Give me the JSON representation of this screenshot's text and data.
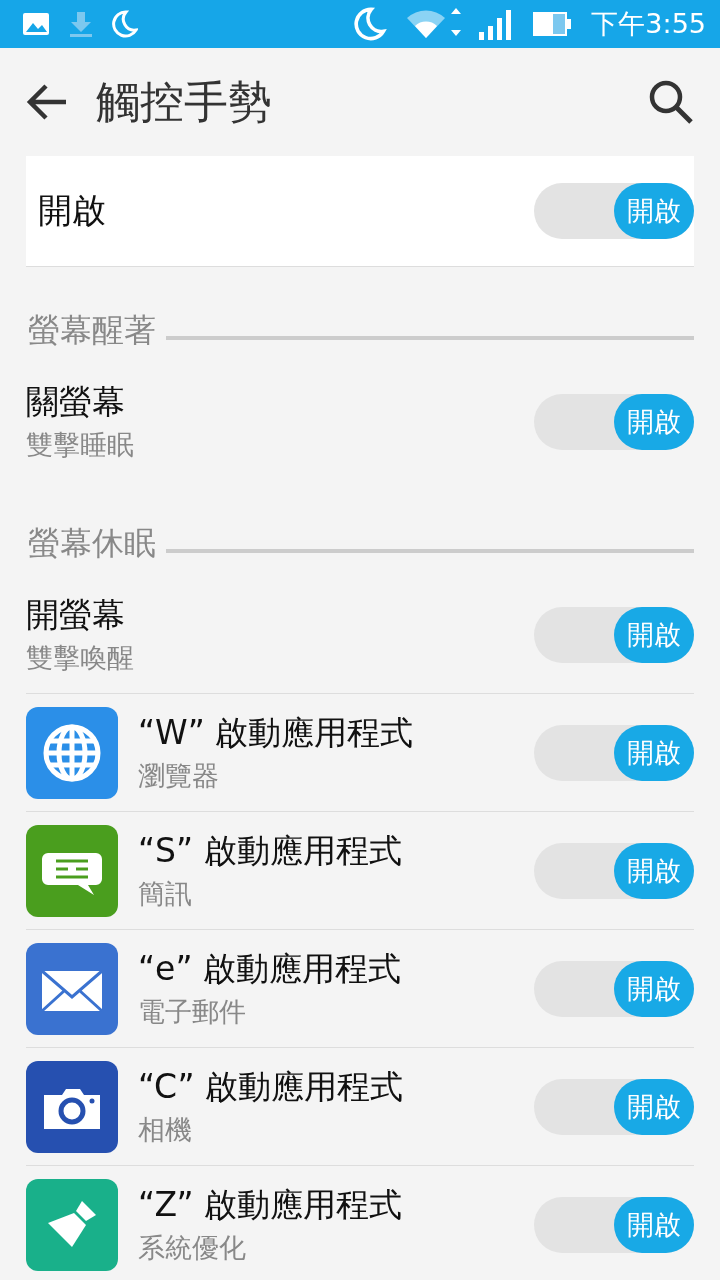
{
  "status_bar": {
    "time": "下午3:55"
  },
  "toolbar": {
    "title": "觸控手勢"
  },
  "master": {
    "label": "開啟",
    "switch": {
      "label": "開啟",
      "on": true
    }
  },
  "sections": [
    {
      "header": "螢幕醒著",
      "rows": [
        {
          "kind": "plain",
          "title": "關螢幕",
          "subtitle": "雙擊睡眠",
          "switch": {
            "label": "開啟",
            "on": true
          }
        }
      ]
    },
    {
      "header": "螢幕休眠",
      "rows": [
        {
          "kind": "plain",
          "title": "開螢幕",
          "subtitle": "雙擊喚醒",
          "switch": {
            "label": "開啟",
            "on": true
          }
        },
        {
          "kind": "globe",
          "title": "“W” 啟動應用程式",
          "subtitle": "瀏覽器",
          "switch": {
            "label": "開啟",
            "on": true
          }
        },
        {
          "kind": "message",
          "title": "“S” 啟動應用程式",
          "subtitle": "簡訊",
          "switch": {
            "label": "開啟",
            "on": true
          }
        },
        {
          "kind": "mail",
          "title": "“e” 啟動應用程式",
          "subtitle": "電子郵件",
          "switch": {
            "label": "開啟",
            "on": true
          }
        },
        {
          "kind": "camera",
          "title": "“C” 啟動應用程式",
          "subtitle": "相機",
          "switch": {
            "label": "開啟",
            "on": true
          }
        },
        {
          "kind": "brush",
          "title": "“Z” 啟動應用程式",
          "subtitle": "系統優化",
          "switch": {
            "label": "開啟",
            "on": true
          }
        }
      ]
    }
  ]
}
